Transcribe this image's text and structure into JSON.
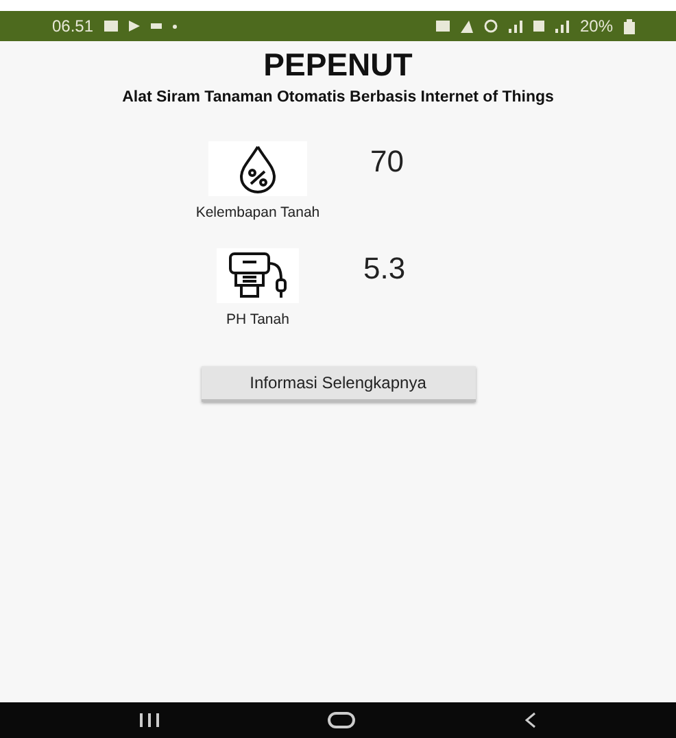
{
  "status_bar": {
    "time": "06.51",
    "battery": "20%"
  },
  "title": "PEPENUT",
  "subtitle": "Alat Siram Tanaman Otomatis Berbasis Internet of Things",
  "sensors": [
    {
      "kind": "humidity",
      "label": "Kelembapan Tanah",
      "value": "70"
    },
    {
      "kind": "ph",
      "label": "PH Tanah",
      "value": "5.3"
    }
  ],
  "button": "Informasi Selengkapnya"
}
